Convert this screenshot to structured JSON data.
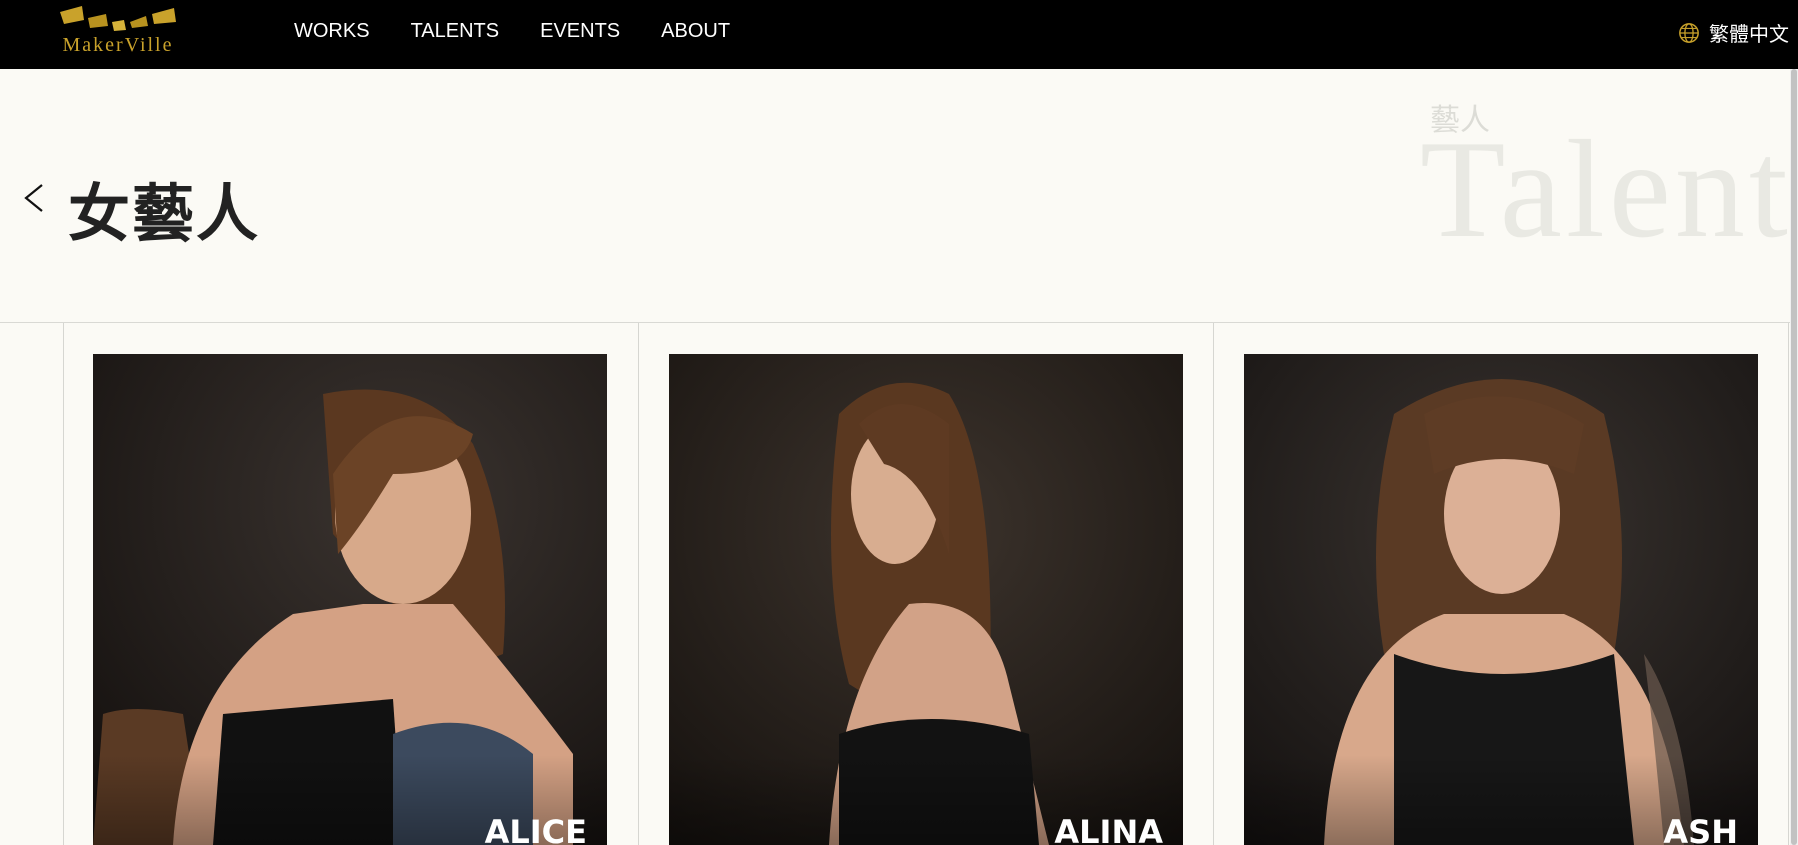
{
  "header": {
    "logo_text": "MakerVille",
    "nav": [
      "WORKS",
      "TALENTS",
      "EVENTS",
      "ABOUT"
    ],
    "language": "繁體中文",
    "accent_color": "#c9a22b"
  },
  "hero": {
    "title": "女藝人",
    "bg_subtitle": "藝人",
    "bg_word": "Talents",
    "back_icon": "chevron-left-icon"
  },
  "talents": [
    {
      "name": "ALICE"
    },
    {
      "name": "ALINA"
    },
    {
      "name": "ASH"
    }
  ]
}
